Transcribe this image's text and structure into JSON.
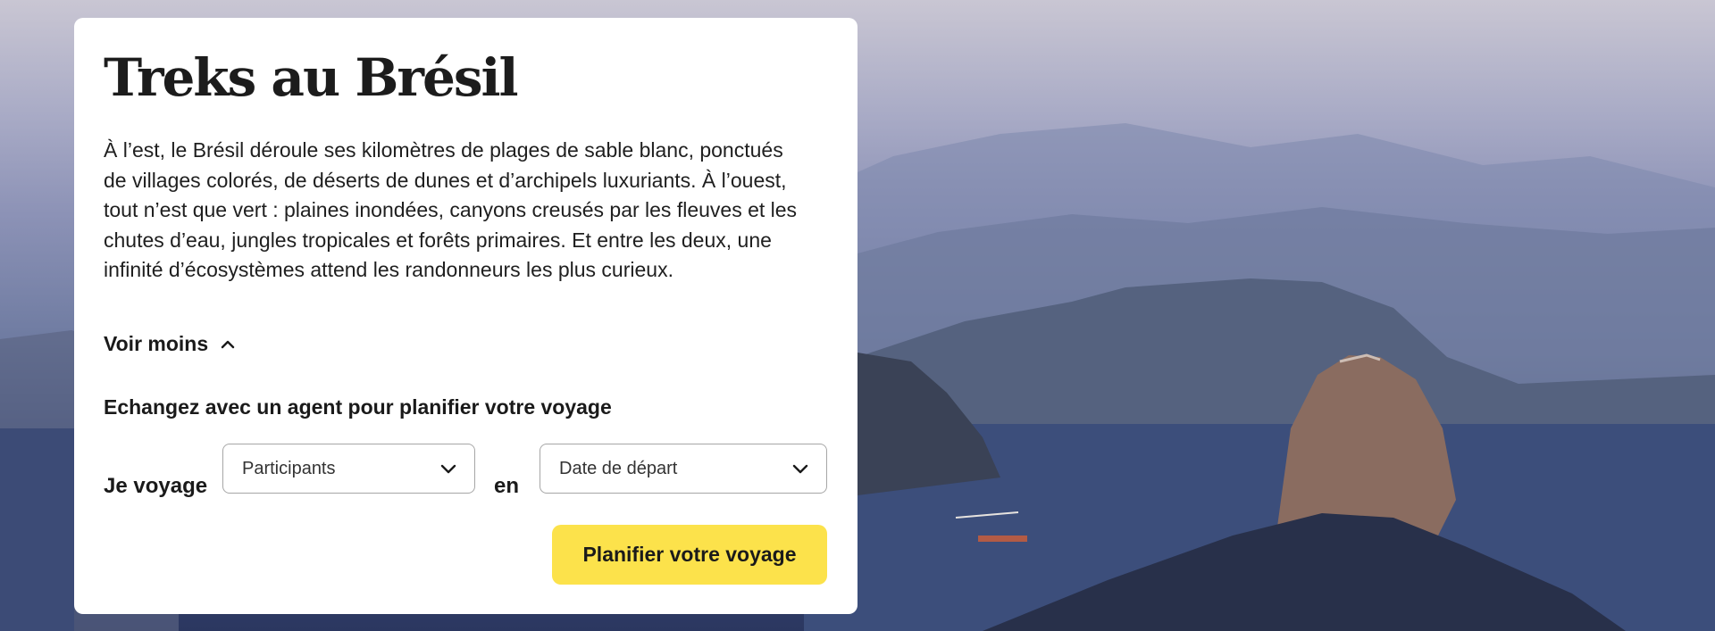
{
  "card": {
    "title": "Treks au Brésil",
    "description": "À l’est, le Brésil déroule ses kilomètres de plages de sable blanc, ponctués de villages colorés, de déserts de dunes et d’archipels luxuriants. À l’ouest, tout n’est que vert : plaines inondées, canyons creusés par les fleuves et les chutes d’eau, jungles tropicales et forêts primaires. Et entre les deux, une infinité d’écosystèmes attend les randonneurs les plus curieux.",
    "toggle_label": "Voir moins",
    "toggle_icon": "chevron-up-icon",
    "planner": {
      "heading": "Echangez avec un agent pour planifier votre voyage",
      "label_travel": "Je voyage",
      "participants_placeholder": "Participants",
      "label_in": "en",
      "date_placeholder": "Date de départ",
      "select_icon": "chevron-down-icon",
      "cta_label": "Planifier votre voyage"
    }
  },
  "colors": {
    "cta_background": "#fce24b",
    "card_background": "#ffffff",
    "text": "#1a1a1a"
  }
}
